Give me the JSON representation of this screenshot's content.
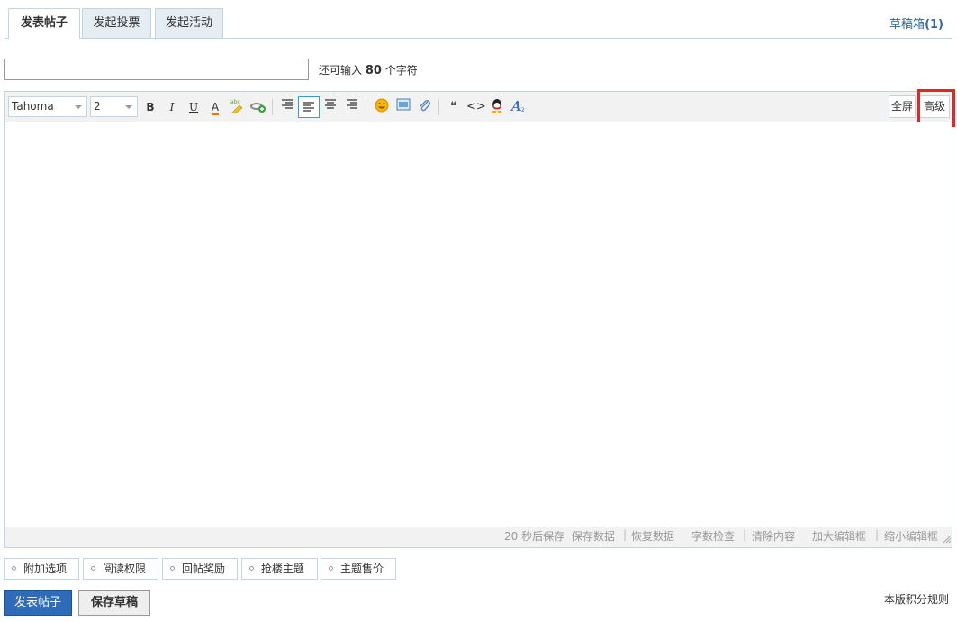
{
  "tabs": [
    {
      "label": "发表帖子",
      "active": true
    },
    {
      "label": "发起投票",
      "active": false
    },
    {
      "label": "发起活动",
      "active": false
    }
  ],
  "drafts": {
    "label": "草稿箱",
    "count": "(1)"
  },
  "subject": {
    "value": "",
    "remaining_prefix": "还可输入",
    "remaining_count": "80",
    "remaining_suffix": "个字符"
  },
  "toolbar": {
    "font_family": "Tahoma",
    "font_size": "2",
    "bold": "B",
    "italic": "I",
    "underline": "U",
    "font_color": "A",
    "quote": "❝",
    "code": "<>",
    "fullscreen_label": "全屏",
    "advanced_label": "高级"
  },
  "statusbar": {
    "autosave": "20 秒后保存",
    "save_data": "保存数据",
    "restore_data": "恢复数据",
    "word_check": "字数检查",
    "clear": "清除内容",
    "enlarge": "加大编辑框",
    "shrink": "缩小编辑框",
    "separator": "|"
  },
  "options": [
    "附加选项",
    "阅读权限",
    "回帖奖励",
    "抢楼主题",
    "主题售价"
  ],
  "actions": {
    "submit_label": "发表帖子",
    "save_draft_label": "保存草稿"
  },
  "rules_link": "本版积分规则",
  "colors": {
    "accent": "#2e6bb8",
    "highlight": "#e52521",
    "border": "#c2d5e3"
  }
}
